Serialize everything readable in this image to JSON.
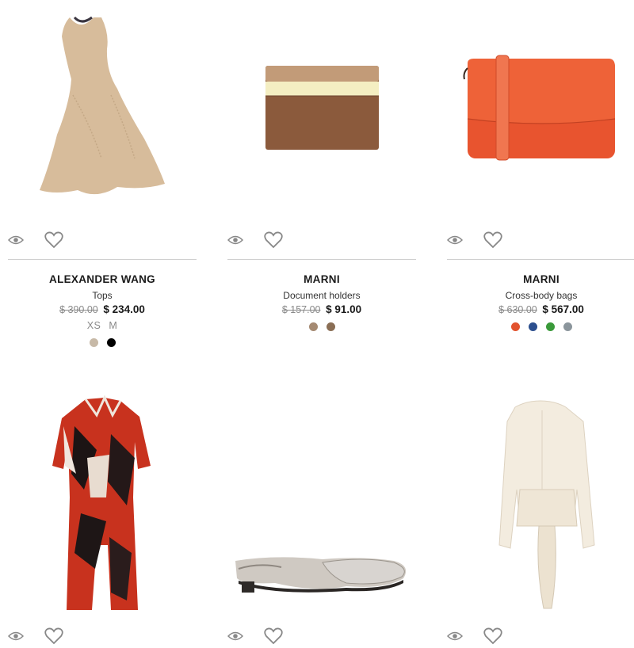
{
  "products": [
    {
      "brand": "ALEXANDER WANG",
      "category": "Tops",
      "old_price": "$ 390.00",
      "price": "$ 234.00",
      "sizes": [
        "XS",
        "M"
      ],
      "colors": [
        "#c7b9a7",
        "#000000"
      ],
      "image_alt": "beige peplum tank top"
    },
    {
      "brand": "MARNI",
      "category": "Document holders",
      "old_price": "$ 157.00",
      "price": "$ 91.00",
      "sizes": [],
      "colors": [
        "#a58a72",
        "#8a6e55"
      ],
      "image_alt": "brown striped card holder"
    },
    {
      "brand": "MARNI",
      "category": "Cross-body bags",
      "old_price": "$ 630.00",
      "price": "$ 567.00",
      "sizes": [],
      "colors": [
        "#e2532e",
        "#2c4f8e",
        "#3a9a3a",
        "#8b959c"
      ],
      "image_alt": "orange cross-body bag"
    },
    {
      "image_alt": "red and black leaf print playsuit"
    },
    {
      "image_alt": "silver slingback flat shoe"
    },
    {
      "image_alt": "cream draped blouse"
    }
  ],
  "icons": {
    "quick_view": "eye-icon",
    "wishlist": "heart-icon"
  }
}
